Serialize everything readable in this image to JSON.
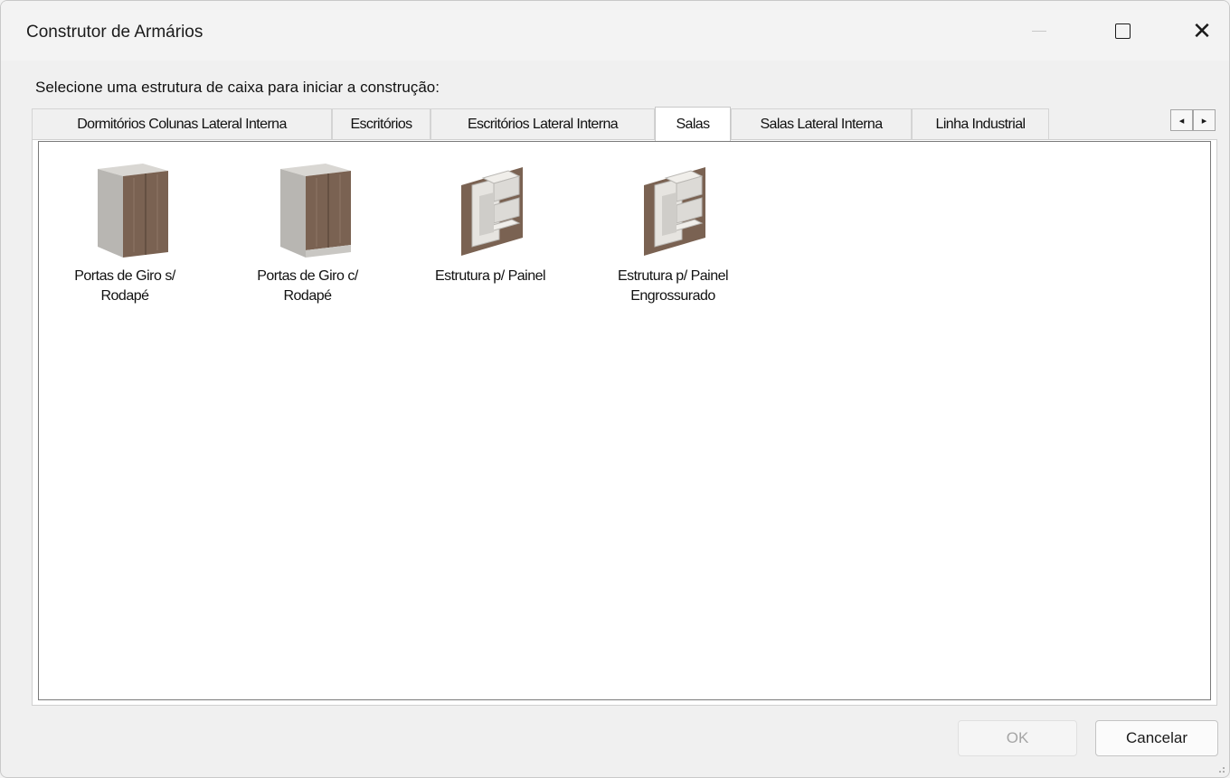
{
  "window": {
    "title": "Construtor de Armários",
    "controls": {
      "minimize": "—",
      "maximize": "□",
      "close": "✕"
    }
  },
  "prompt": "Selecione uma estrutura de caixa para iniciar a construção:",
  "tabs": [
    {
      "label": "Dormitórios Colunas Lateral Interna",
      "active": false
    },
    {
      "label": "Escritórios",
      "active": false
    },
    {
      "label": "Escritórios Lateral Interna",
      "active": false
    },
    {
      "label": "Salas",
      "active": true
    },
    {
      "label": "Salas Lateral Interna",
      "active": false
    },
    {
      "label": "Linha Industrial",
      "active": false
    }
  ],
  "tab_scroll": {
    "left": "◂",
    "right": "▸"
  },
  "items": [
    {
      "label": "Portas de Giro s/\nRodapé",
      "icon": "cabinet-icon"
    },
    {
      "label": "Portas de Giro c/\nRodapé",
      "icon": "cabinet-base-icon"
    },
    {
      "label": "Estrutura p/ Painel",
      "icon": "panel-shelf-icon"
    },
    {
      "label": "Estrutura p/ Painel\nEngrossurado",
      "icon": "panel-shelf-icon"
    }
  ],
  "buttons": {
    "ok": "OK",
    "ok_enabled": false,
    "cancel": "Cancelar"
  },
  "colors": {
    "wood": "#7a6252",
    "body": "#b8b6b2",
    "top": "#d9d7d3",
    "shelf": "#e6e4e0"
  }
}
